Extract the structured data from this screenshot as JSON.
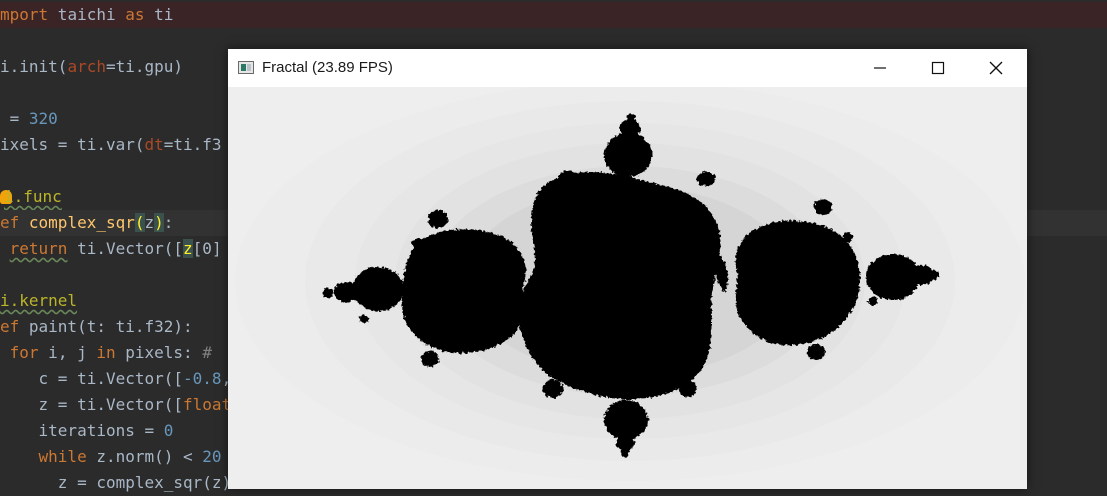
{
  "editor": {
    "lines": {
      "l1": {
        "kw": "mport",
        "rest1": " taichi ",
        "kw2": "as",
        "rest2": " ti"
      },
      "l2": {
        "pre": "i.init(",
        "param": "arch",
        "post": "=ti.gpu)"
      },
      "l3": {
        "pre": " = ",
        "num": "320"
      },
      "l4": {
        "pre": "ixels = ti.var(",
        "param": "dt",
        "post": "=ti.f3"
      },
      "l5": {
        "dec": "i.func"
      },
      "l6": {
        "kw": "ef",
        "sp": " ",
        "fn": "complex_sqr",
        "open": "(",
        "arg": "z",
        "close": ")",
        "colon": ":"
      },
      "l7": {
        "indent": " ",
        "kw": "return",
        "rest": " ti.Vector([",
        "z": "z",
        "tail": "[0]"
      },
      "l8": {
        "dec": "i.kernel"
      },
      "l9": {
        "kw": "ef",
        "rest": " paint(t: ti.f32):"
      },
      "l10": {
        "indent": " ",
        "kw": "for",
        "mid": " i, j ",
        "kw2": "in",
        "rest": " pixels: ",
        "cmt": "#"
      },
      "l11": {
        "pre": "    c = ti.Vector([",
        "num": "-0.8",
        "post": ","
      },
      "l12": {
        "pre": "    z = ti.Vector([",
        "kw": "float"
      },
      "l13": {
        "pre": "    iterations = ",
        "num": "0"
      },
      "l14": {
        "indent": "    ",
        "kw": "while",
        "mid": " z.norm() < ",
        "num": "20"
      },
      "l15": {
        "pre": "      z = complex_sqr(z)"
      }
    }
  },
  "window": {
    "title": "Fractal (23.89 FPS)",
    "icon": "app-window-icon",
    "controls": [
      "minimize-icon",
      "maximize-icon",
      "close-icon"
    ]
  },
  "colors": {
    "editor_bg": "#2b2b2b",
    "keyword": "#cc7832",
    "number": "#6897bb",
    "decorator": "#bbb529",
    "function": "#ffc66d",
    "fractal_fill": "#000000",
    "fractal_bg": "#eeeeee"
  }
}
